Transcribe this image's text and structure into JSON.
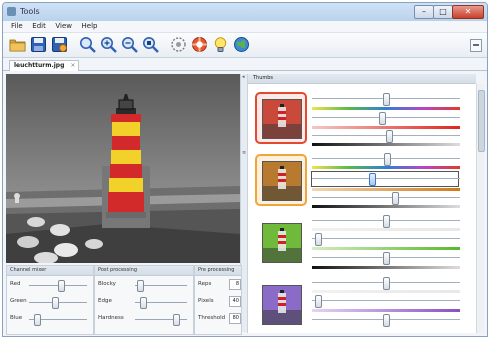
{
  "window": {
    "title": "Tools",
    "controls": {
      "minimize": "–",
      "maximize": "□",
      "close": "✕"
    }
  },
  "menu": [
    "File",
    "Edit",
    "View",
    "Help"
  ],
  "toolbar": {
    "tools": [
      "open-folder-icon",
      "save-icon",
      "save-as-icon",
      "zoom-fit-icon",
      "zoom-in-icon",
      "zoom-out-icon",
      "zoom-actual-icon",
      "filter-icon",
      "settings-icon",
      "tip-icon",
      "globe-icon"
    ]
  },
  "tab": {
    "label": "leuchtturm.jpg",
    "close": "×"
  },
  "thumbs_panel": {
    "title": "Thumbs",
    "items": [
      {
        "tint": "#c94a3b",
        "selected": "red",
        "slider1": 0.5,
        "slider2": 0.47,
        "slider3": 0.52
      },
      {
        "tint": "#b77a2e",
        "selected": "orange",
        "slider1": 0.51,
        "slider2": 0.4,
        "slider3": 0.56
      },
      {
        "tint": "#6fba3a",
        "selected": "",
        "slider1": 0.5,
        "slider2": 0.02,
        "slider3": 0.5
      },
      {
        "tint": "#8a6cc8",
        "selected": "",
        "slider1": 0.5,
        "slider2": 0.02,
        "slider3": 0.5
      }
    ]
  },
  "panels": {
    "channel_mixer": {
      "title": "Channel mixer",
      "rows": [
        {
          "label": "Red",
          "level": 0.55
        },
        {
          "label": "Green",
          "level": 0.45
        },
        {
          "label": "Blue",
          "level": 0.1
        }
      ]
    },
    "post_processing": {
      "title": "Post processing",
      "rows": [
        {
          "label": "Blocky",
          "level": 0.04
        },
        {
          "label": "Edge",
          "level": 0.1
        },
        {
          "label": "Hardness",
          "level": 0.82
        }
      ]
    },
    "pre_processing": {
      "title": "Pre processing",
      "rows": [
        {
          "label": "Reps",
          "value": "8"
        },
        {
          "label": "Pixels",
          "value": "40"
        },
        {
          "label": "Threshold",
          "value": "80"
        }
      ]
    }
  }
}
